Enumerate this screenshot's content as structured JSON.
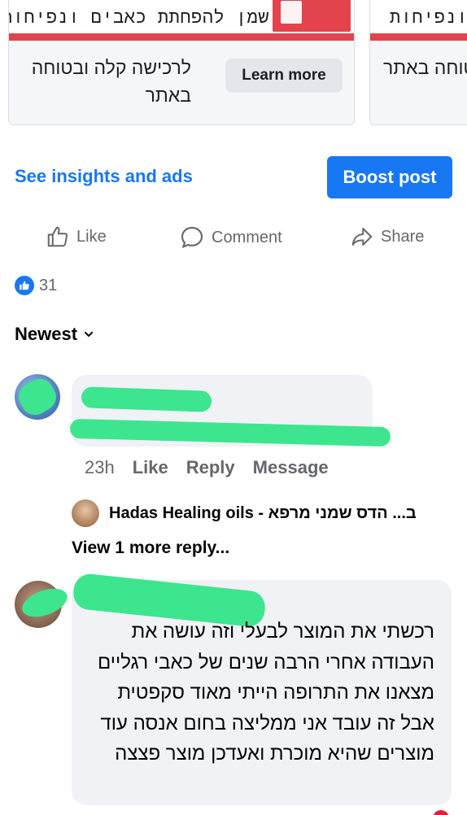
{
  "carousel": {
    "cards": [
      {
        "title": "שמן להפחתת כאבים ונפיחות",
        "description": "לרכישה קלה ובטוחה באתר",
        "button_label": "Learn more"
      },
      {
        "title": "ונפיחות",
        "description": "לה ובטוחה באתר"
      }
    ]
  },
  "post_actions": {
    "insights_label": "See insights and ads",
    "boost_label": "Boost post",
    "like_label": "Like",
    "comment_label": "Comment",
    "share_label": "Share"
  },
  "reactions": {
    "count": "31"
  },
  "sort": {
    "label": "Newest"
  },
  "comments": [
    {
      "timestamp": "23h",
      "like_label": "Like",
      "reply_label": "Reply",
      "message_label": "Message",
      "reply_preview": "ב... הדס שמני מרפא - Hadas Healing oils",
      "view_more_label": "View 1 more reply..."
    },
    {
      "text": "רכשתי את המוצר לבעלי וזה עושה את העבודה אחרי הרבה שנים של כאבי רגליים מצאנו את התרופה הייתי מאוד סקפטית אבל זה עובד אני ממליצה בחום אנסה עוד מוצרים שהיא מוכרת ואעדכן מוצר פצצה"
    }
  ],
  "colors": {
    "accent": "#1877f2",
    "brand_red": "#e3434d",
    "redaction_green": "#3de58f"
  }
}
